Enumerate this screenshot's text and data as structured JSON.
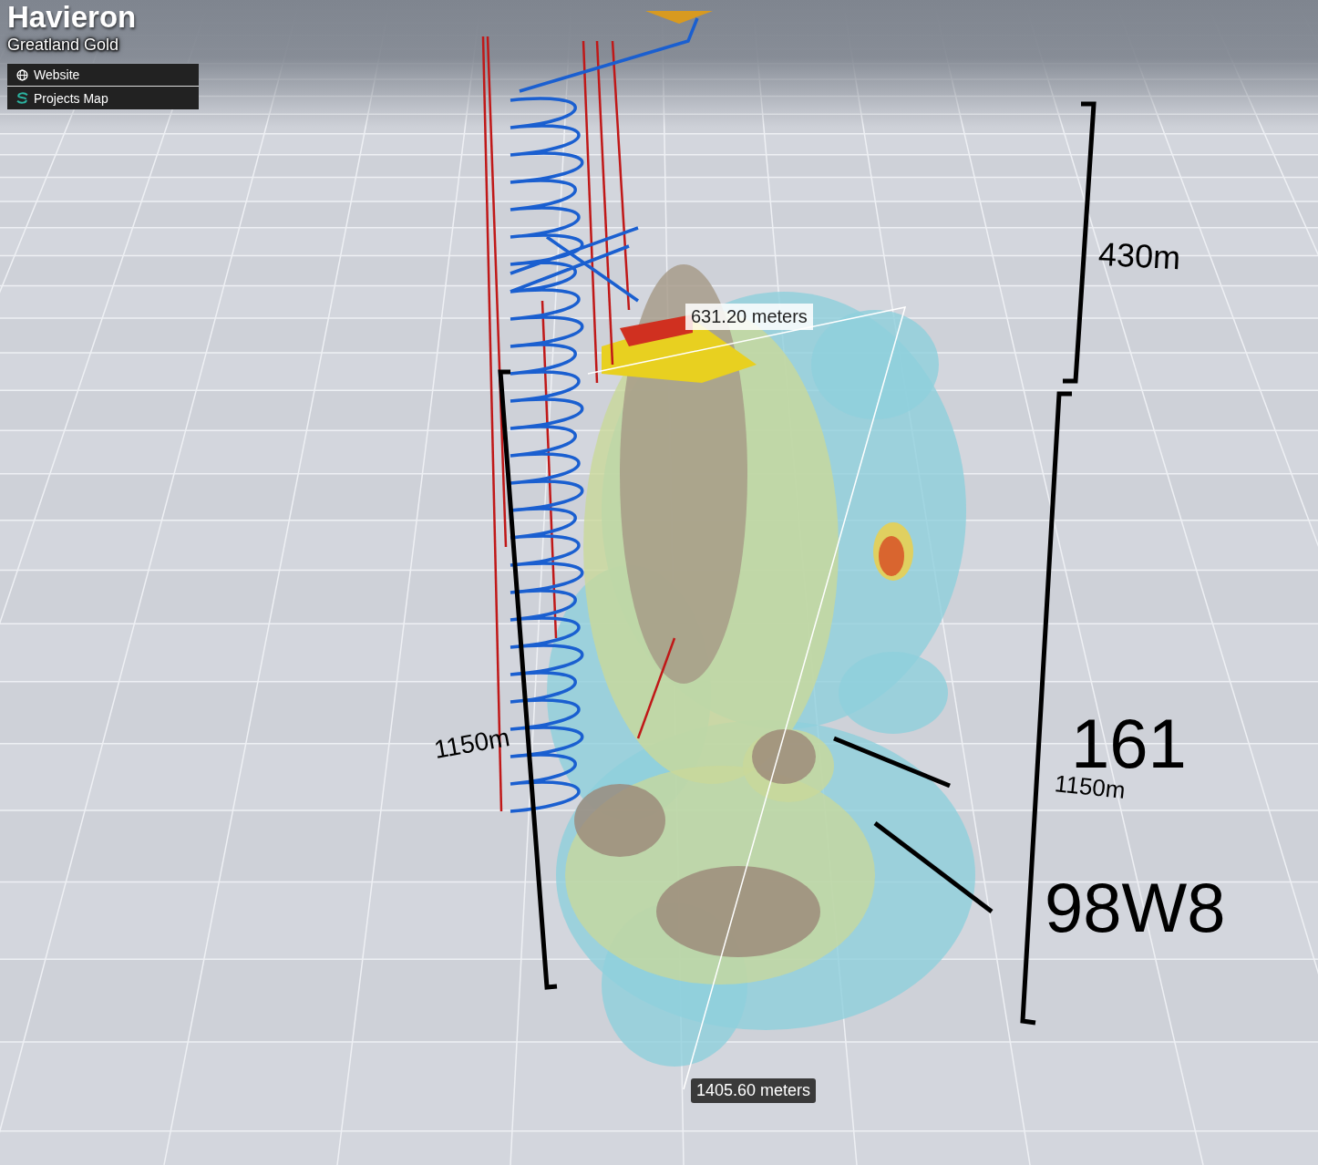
{
  "header": {
    "title": "Havieron",
    "subtitle": "Greatland Gold"
  },
  "links": [
    {
      "label": "Website",
      "kind": "web"
    },
    {
      "label": "Projects Map",
      "kind": "map"
    }
  ],
  "scene": {
    "scale_labels": [
      "430m",
      "1150m",
      "1150m"
    ],
    "annotations": [
      "161",
      "98W8"
    ],
    "measurements": [
      {
        "label": "631.20 meters",
        "kind": "light"
      },
      {
        "label": "1405.60 meters",
        "kind": "dark"
      }
    ]
  }
}
